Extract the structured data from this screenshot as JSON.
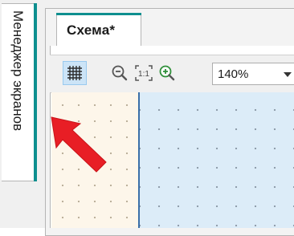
{
  "sidebar": {
    "screens_tab_label": "Менеджер экранов"
  },
  "document": {
    "tab_label": "Схема*"
  },
  "toolbar": {
    "grid_icon": "grid-icon",
    "zoom_out_icon": "zoom-out-icon",
    "actual_size_icon": "actual-size-icon",
    "actual_size_label": "1:1",
    "zoom_in_icon": "zoom-in-icon",
    "zoom_value": "140%"
  },
  "colors": {
    "accent": "#0e8f8f",
    "selected_button": "#cce4f7",
    "canvas_main": "#dcecf8",
    "canvas_side": "#fdf6ea",
    "pointer": "#e81e25"
  }
}
